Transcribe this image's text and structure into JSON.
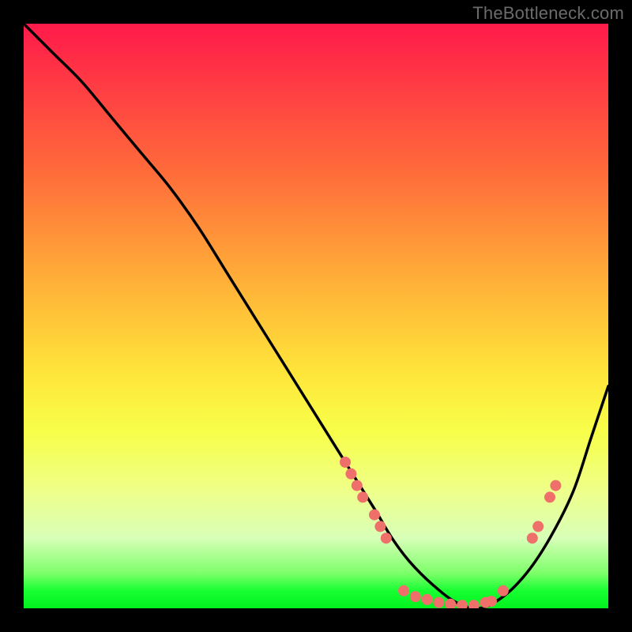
{
  "watermark": "TheBottleneck.com",
  "chart_data": {
    "type": "line",
    "title": "",
    "xlabel": "",
    "ylabel": "",
    "xlim": [
      0,
      100
    ],
    "ylim": [
      0,
      100
    ],
    "series": [
      {
        "name": "bottleneck-curve",
        "x": [
          0,
          5,
          10,
          15,
          20,
          25,
          30,
          35,
          40,
          45,
          50,
          55,
          60,
          63,
          66,
          70,
          74,
          78,
          82,
          86,
          90,
          94,
          97,
          100
        ],
        "y": [
          100,
          95,
          90,
          84,
          78,
          72,
          65,
          57,
          49,
          41,
          33,
          25,
          17,
          12,
          8,
          4,
          1,
          0,
          2,
          6,
          12,
          20,
          29,
          38
        ]
      }
    ],
    "markers": [
      {
        "name": "scatter-left-band",
        "points": [
          {
            "x": 55,
            "y": 25
          },
          {
            "x": 56,
            "y": 23
          },
          {
            "x": 57,
            "y": 21
          },
          {
            "x": 58,
            "y": 19
          },
          {
            "x": 60,
            "y": 16
          },
          {
            "x": 61,
            "y": 14
          },
          {
            "x": 62,
            "y": 12
          }
        ]
      },
      {
        "name": "scatter-bottom-band",
        "points": [
          {
            "x": 65,
            "y": 3
          },
          {
            "x": 67,
            "y": 2
          },
          {
            "x": 69,
            "y": 1.5
          },
          {
            "x": 71,
            "y": 1
          },
          {
            "x": 73,
            "y": 0.7
          },
          {
            "x": 75,
            "y": 0.5
          },
          {
            "x": 77,
            "y": 0.5
          },
          {
            "x": 79,
            "y": 1
          },
          {
            "x": 80,
            "y": 1.2
          },
          {
            "x": 82,
            "y": 3
          }
        ]
      },
      {
        "name": "scatter-right-band",
        "points": [
          {
            "x": 87,
            "y": 12
          },
          {
            "x": 88,
            "y": 14
          },
          {
            "x": 90,
            "y": 19
          },
          {
            "x": 91,
            "y": 21
          }
        ]
      }
    ],
    "colors": {
      "curve_stroke": "#000000",
      "marker_fill": "#ef6f6b"
    }
  }
}
